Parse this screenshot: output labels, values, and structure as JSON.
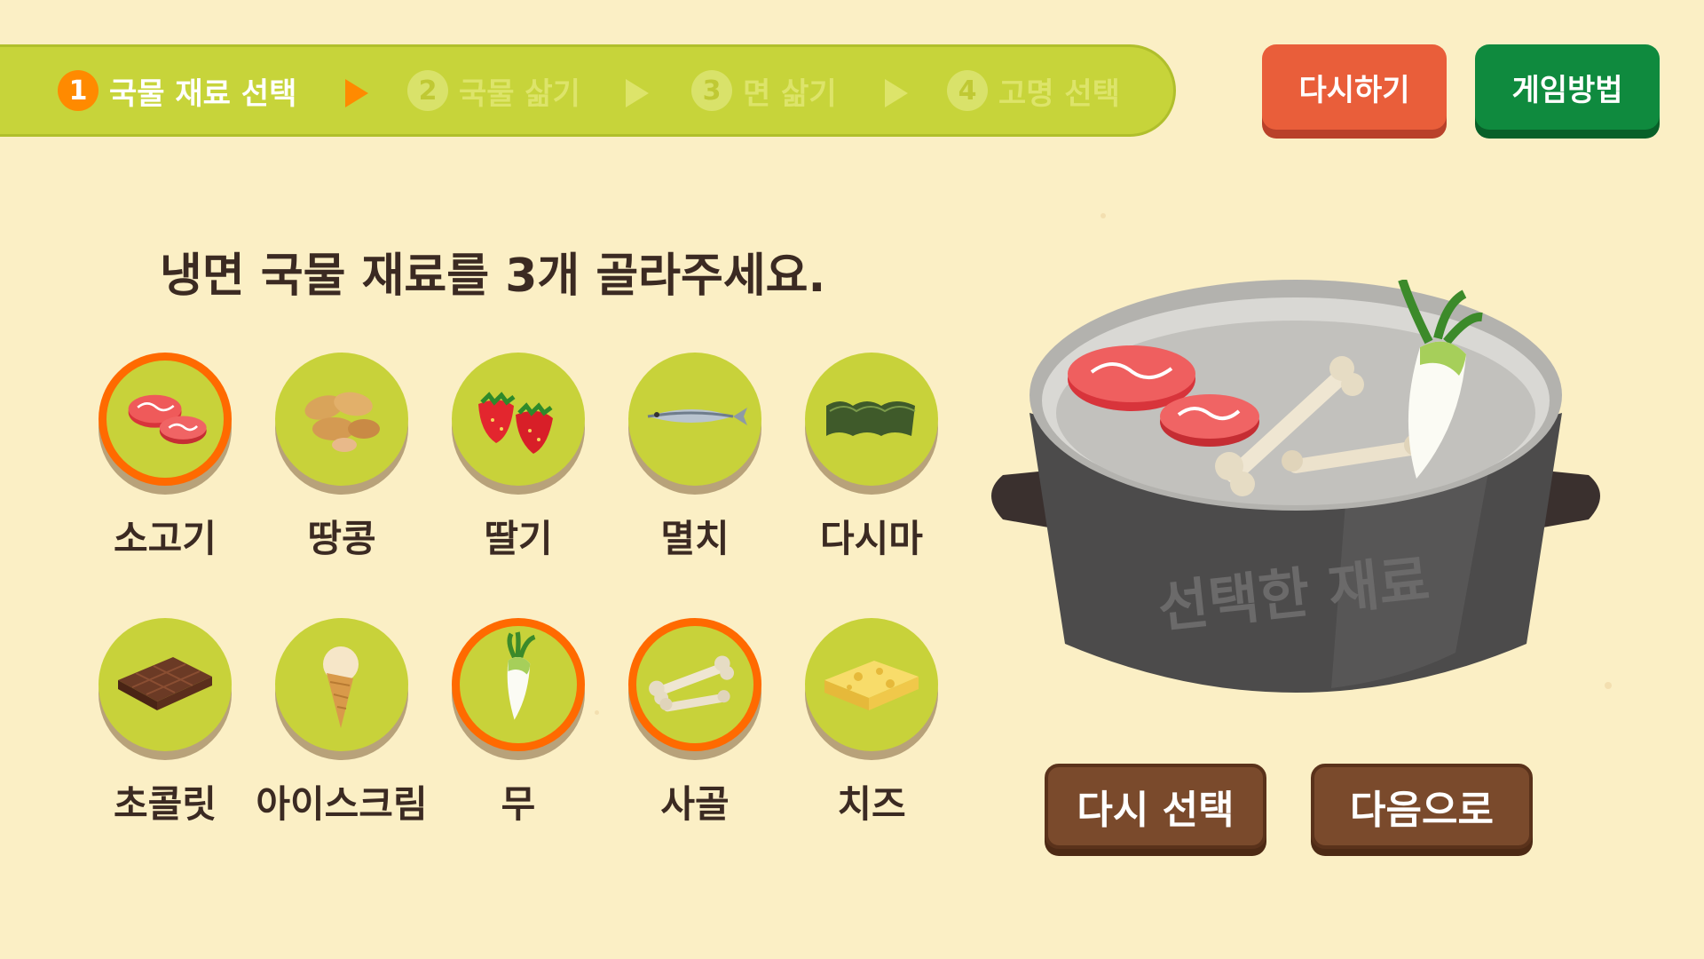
{
  "steps": [
    {
      "num": "1",
      "label": "국물 재료 선택",
      "state": "active"
    },
    {
      "num": "2",
      "label": "국물 삶기",
      "state": "inactive"
    },
    {
      "num": "3",
      "label": "면 삶기",
      "state": "inactive"
    },
    {
      "num": "4",
      "label": "고명 선택",
      "state": "inactive"
    }
  ],
  "top_buttons": {
    "restart": "다시하기",
    "how_to_play": "게임방법"
  },
  "instruction": "냉면 국물 재료를 3개 골라주세요.",
  "ingredients": [
    {
      "label": "소고기",
      "icon": "beef-icon",
      "selected": true
    },
    {
      "label": "땅콩",
      "icon": "peanut-icon",
      "selected": false
    },
    {
      "label": "딸기",
      "icon": "strawberry-icon",
      "selected": false
    },
    {
      "label": "멸치",
      "icon": "anchovy-icon",
      "selected": false
    },
    {
      "label": "다시마",
      "icon": "kelp-icon",
      "selected": false
    },
    {
      "label": "초콜릿",
      "icon": "chocolate-icon",
      "selected": false
    },
    {
      "label": "아이스크림",
      "icon": "ice-cream-icon",
      "selected": false
    },
    {
      "label": "무",
      "icon": "radish-icon",
      "selected": true
    },
    {
      "label": "사골",
      "icon": "beef-bone-icon",
      "selected": true
    },
    {
      "label": "치즈",
      "icon": "cheese-icon",
      "selected": false
    }
  ],
  "pot": {
    "label": "선택한 재료",
    "contents": [
      "beef-icon",
      "beef-bone-icon",
      "radish-icon"
    ]
  },
  "bottom_buttons": {
    "reselect": "다시 선택",
    "next": "다음으로"
  },
  "colors": {
    "background": "#fbefc5",
    "step_bar": "#c7d43a",
    "active_step": "#ff8a00",
    "selected_ring": "#ff6a00",
    "restart_button": "#e95e3a",
    "how_to_button": "#0f8a3e",
    "brown_button": "#7a4a2c"
  }
}
